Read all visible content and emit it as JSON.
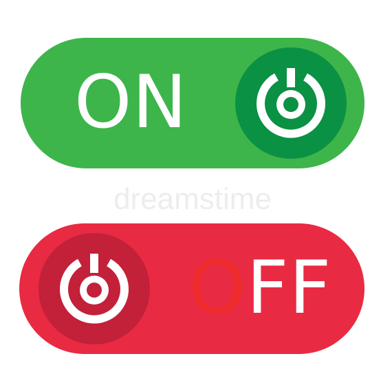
{
  "on_toggle": {
    "label": "ON",
    "track_color": "#3db54a",
    "knob_color": "#0a9144",
    "icon": "power-icon"
  },
  "off_toggle": {
    "label_first": "O",
    "label_rest": "FF",
    "track_color": "#e92a43",
    "knob_color": "#c3203a",
    "accent_color": "#ef2b2b",
    "icon": "power-icon"
  },
  "watermark": {
    "text": "dreamstime"
  }
}
